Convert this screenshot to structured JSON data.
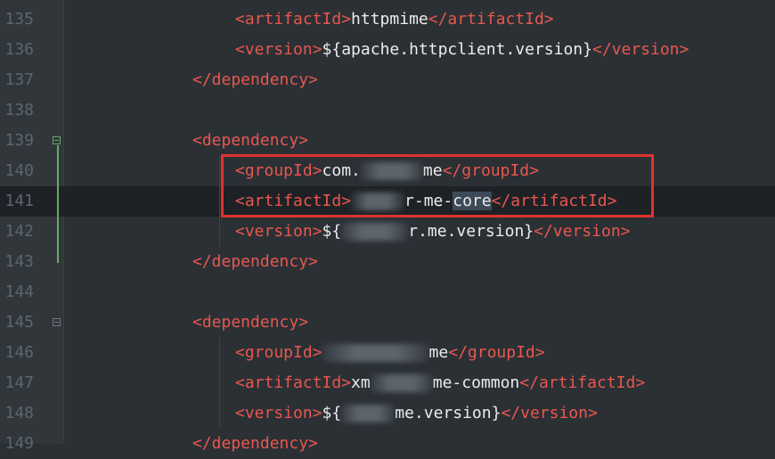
{
  "editor": {
    "lines": [
      {
        "num": "135",
        "parts": [
          {
            "t": "<artifactId>",
            "c": "tag"
          },
          {
            "t": "httpmime",
            "c": "val"
          },
          {
            "t": "</artifactId>",
            "c": "tag"
          }
        ]
      },
      {
        "num": "136",
        "parts": [
          {
            "t": "<version>",
            "c": "tag"
          },
          {
            "t": "${apache.httpclient.version}",
            "c": "val"
          },
          {
            "t": "</version>",
            "c": "tag"
          }
        ]
      },
      {
        "num": "137",
        "parts": [
          {
            "t": "</dependency>",
            "c": "tag"
          }
        ]
      },
      {
        "num": "138",
        "parts": []
      },
      {
        "num": "139",
        "parts": [
          {
            "t": "<dependency>",
            "c": "tag"
          }
        ]
      },
      {
        "num": "140",
        "parts": [
          {
            "t": "<groupId>",
            "c": "tag"
          },
          {
            "t": "com.",
            "c": "val"
          },
          {
            "blur": true
          },
          {
            "t": "me",
            "c": "val"
          },
          {
            "t": "</groupId>",
            "c": "tag"
          }
        ]
      },
      {
        "num": "141",
        "parts": [
          {
            "t": "<artifactId>",
            "c": "tag"
          },
          {
            "blur": true
          },
          {
            "t": "r-me-",
            "c": "val"
          },
          {
            "t": "core",
            "c": "val sel"
          },
          {
            "t": "</artifactId>",
            "c": "tag"
          }
        ]
      },
      {
        "num": "142",
        "parts": [
          {
            "t": "<version>",
            "c": "tag"
          },
          {
            "t": "${",
            "c": "val"
          },
          {
            "blur": true
          },
          {
            "t": "r.me.version}",
            "c": "val"
          },
          {
            "t": "</version>",
            "c": "tag"
          }
        ]
      },
      {
        "num": "143",
        "parts": [
          {
            "t": "</dependency>",
            "c": "tag"
          }
        ]
      },
      {
        "num": "144",
        "parts": []
      },
      {
        "num": "145",
        "parts": [
          {
            "t": "<dependency>",
            "c": "tag"
          }
        ]
      },
      {
        "num": "146",
        "parts": [
          {
            "t": "<groupId>",
            "c": "tag"
          },
          {
            "blur": true
          },
          {
            "t": "me",
            "c": "val"
          },
          {
            "t": "</groupId>",
            "c": "tag"
          }
        ]
      },
      {
        "num": "147",
        "parts": [
          {
            "t": "<artifactId>",
            "c": "tag"
          },
          {
            "t": "xm",
            "c": "val"
          },
          {
            "blur": true
          },
          {
            "t": "me-common",
            "c": "val"
          },
          {
            "t": "</artifactId>",
            "c": "tag"
          }
        ]
      },
      {
        "num": "148",
        "parts": [
          {
            "t": "<version>",
            "c": "tag"
          },
          {
            "t": "${",
            "c": "val"
          },
          {
            "blur": true
          },
          {
            "t": "me.version}",
            "c": "val"
          },
          {
            "t": "</version>",
            "c": "tag"
          }
        ]
      },
      {
        "num": "149",
        "parts": [
          {
            "t": "</dependency>",
            "c": "tag"
          }
        ]
      }
    ],
    "current_line": "141",
    "colors": {
      "tag": "#e8574e",
      "text": "#ececec",
      "gutter_number": "#5d666d",
      "highlight_box": "#e0322d",
      "background": "#2b3035"
    }
  }
}
